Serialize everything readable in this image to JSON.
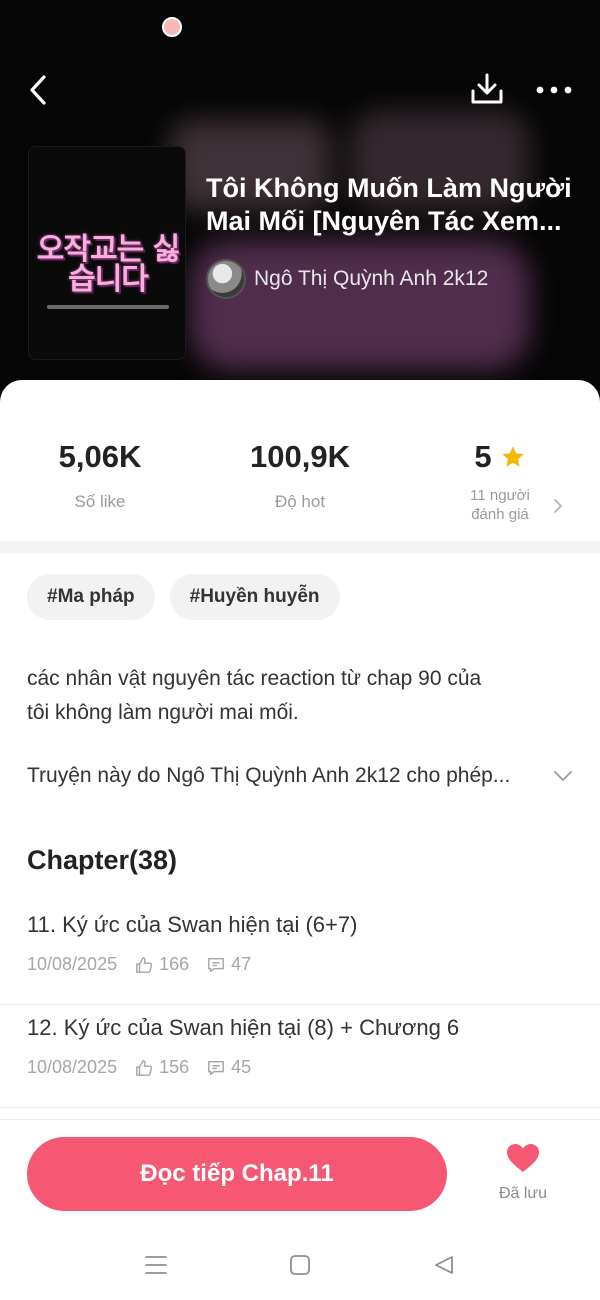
{
  "header": {
    "title_line1": "Tôi Không Muốn Làm Người",
    "title_line2": "Mai Mối [Nguyên Tác Xem...",
    "author": "Ngô Thị Quỳnh Anh 2k12",
    "cover_text": "오작교는 싫습니다",
    "icons": {
      "back": "back-arrow-icon",
      "download": "download-icon",
      "more": "more-dots-icon"
    }
  },
  "stats": {
    "likes": {
      "value": "5,06K",
      "label": "Số like"
    },
    "hot": {
      "value": "100,9K",
      "label": "Độ hot"
    },
    "rating": {
      "value": "5",
      "label_line1": "11 người",
      "label_line2": "đánh giá"
    }
  },
  "tags": [
    "#Ma pháp",
    "#Huyền huyễn"
  ],
  "description": {
    "line1": "các nhân vật nguyên tác reaction từ chap 90 của",
    "line2": "tôi không làm người mai mối.",
    "permission": "Truyện này do Ngô Thị Quỳnh Anh 2k12 cho phép..."
  },
  "chapters": {
    "heading": "Chapter(38)",
    "items": [
      {
        "title": "11. Ký ức của Swan hiện tại (6+7)",
        "date": "10/08/2025",
        "likes": "166",
        "comments": "47"
      },
      {
        "title": "12. Ký ức của Swan hiện tại (8) + Chương 6",
        "date": "10/08/2025",
        "likes": "156",
        "comments": "45"
      }
    ]
  },
  "bottom": {
    "read_label": "Đọc tiếp Chap.11",
    "save_label": "Đã lưu"
  },
  "colors": {
    "accent": "#f65873",
    "star": "#f5b800",
    "header_bg": "#050505"
  }
}
